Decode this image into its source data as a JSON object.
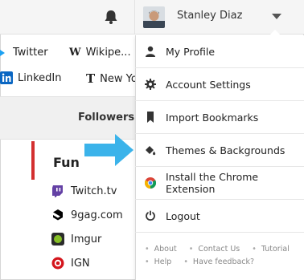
{
  "header": {
    "username": "Stanley Diaz",
    "icons": [
      "bell-icon",
      "avatar",
      "caret-down-icon"
    ]
  },
  "bookmarks": [
    {
      "label": "Twitter",
      "icon": "twitter-icon"
    },
    {
      "label": "Wikipe...",
      "icon": "wikipedia-icon"
    },
    {
      "label": "LinkedIn",
      "icon": "linkedin-icon"
    },
    {
      "label": "New Yo",
      "icon": "nyt-icon"
    }
  ],
  "followers_label": "Followers:",
  "section": {
    "title": "Fun",
    "sites": [
      {
        "label": "Twitch.tv",
        "icon": "twitch-icon",
        "color": "#6441a5"
      },
      {
        "label": "9gag.com",
        "icon": "9gag-icon",
        "color": "#000000"
      },
      {
        "label": "Imgur",
        "icon": "imgur-icon",
        "color": "#85bf25"
      },
      {
        "label": "IGN",
        "icon": "ign-icon",
        "color": "#d4151c"
      }
    ]
  },
  "menu": {
    "items": [
      {
        "label": "My Profile",
        "icon": "person-icon"
      },
      {
        "label": "Account Settings",
        "icon": "gear-icon"
      },
      {
        "label": "Import Bookmarks",
        "icon": "bookmark-icon"
      },
      {
        "label": "Themes & Backgrounds",
        "icon": "paint-bucket-icon"
      },
      {
        "label": "Install the Chrome Extension",
        "icon": "chrome-icon"
      },
      {
        "label": "Logout",
        "icon": "power-icon"
      }
    ],
    "footer": {
      "row1": [
        "About",
        "Contact Us",
        "Tutorial"
      ],
      "row2": [
        "Help",
        "Have feedback?"
      ]
    }
  },
  "colors": {
    "accent_arrow": "#3bb3ea",
    "section_bar": "#d32f2f"
  }
}
